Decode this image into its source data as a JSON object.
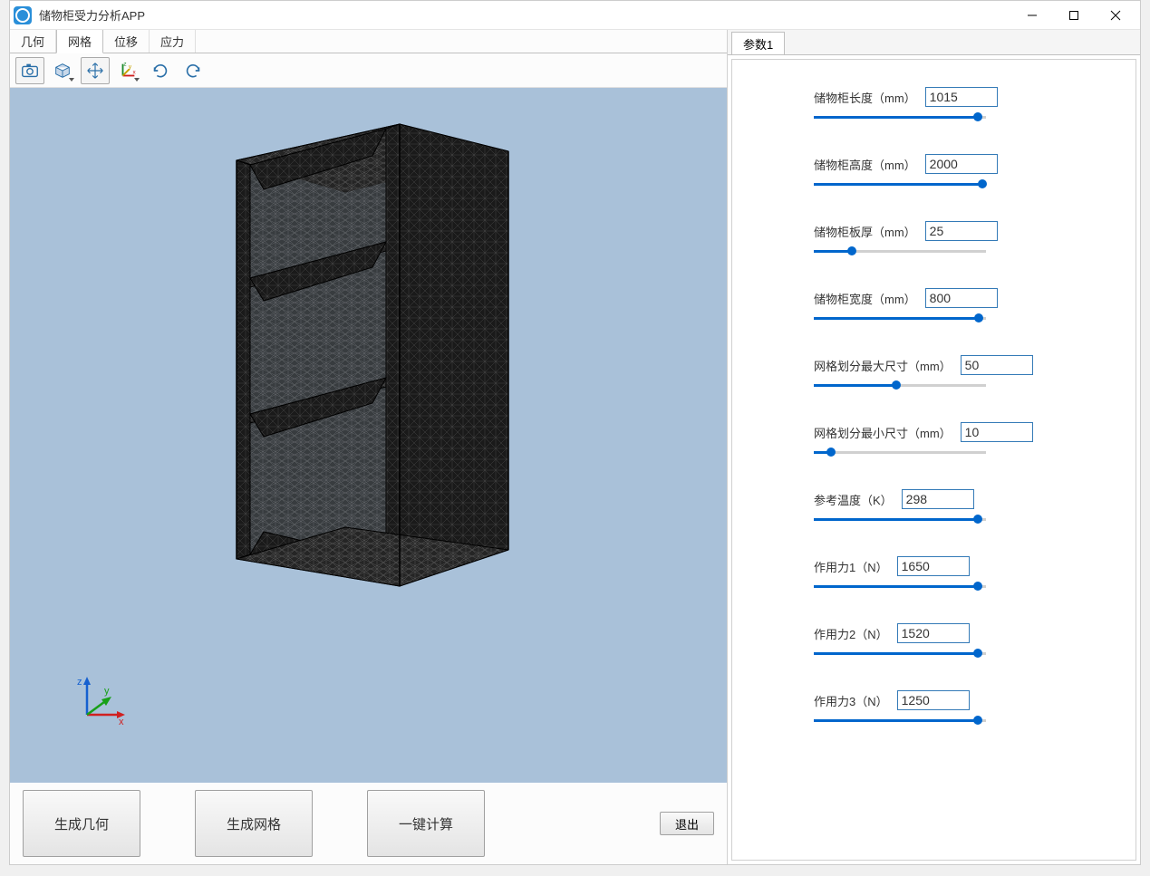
{
  "app": {
    "title": "储物柜受力分析APP"
  },
  "tabs": {
    "items": [
      "几何",
      "网格",
      "位移",
      "应力"
    ],
    "active_index": 1
  },
  "toolbar": {
    "icons": [
      "camera",
      "view-cube",
      "move",
      "axes",
      "rotate-ccw",
      "rotate-cw"
    ]
  },
  "buttons": {
    "geometry": "生成几何",
    "mesh": "生成网格",
    "compute": "一键计算",
    "exit": "退出"
  },
  "right_tab": "参数1",
  "parameters": [
    {
      "label": "储物柜长度（mm）",
      "value": "1015",
      "pct": 95
    },
    {
      "label": "储物柜高度（mm）",
      "value": "2000",
      "pct": 98
    },
    {
      "label": "储物柜板厚（mm）",
      "value": "25",
      "pct": 22
    },
    {
      "label": "储物柜宽度（mm）",
      "value": "800",
      "pct": 96
    },
    {
      "label": "网格划分最大尺寸（mm）",
      "value": "50",
      "pct": 48
    },
    {
      "label": "网格划分最小尺寸（mm）",
      "value": "10",
      "pct": 10
    },
    {
      "label": "参考温度（K）",
      "value": "298",
      "pct": 95
    },
    {
      "label": "作用力1（N）",
      "value": "1650",
      "pct": 95
    },
    {
      "label": "作用力2（N）",
      "value": "1520",
      "pct": 95
    },
    {
      "label": "作用力3（N）",
      "value": "1250",
      "pct": 95
    }
  ],
  "axes": {
    "x": "x",
    "y": "y",
    "z": "z"
  }
}
